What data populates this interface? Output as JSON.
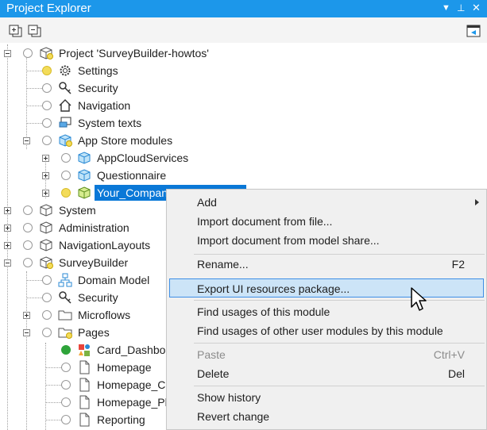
{
  "panel": {
    "title": "Project Explorer"
  },
  "tree": {
    "project": "Project 'SurveyBuilder-howtos'",
    "settings": "Settings",
    "security": "Security",
    "navigation": "Navigation",
    "system_texts": "System texts",
    "app_store_modules": "App Store modules",
    "app_cloud_services": "AppCloudServices",
    "questionnaire": "Questionnaire",
    "your_company": "Your_CompanyUI_R",
    "system": "System",
    "administration": "Administration",
    "navigation_layouts": "NavigationLayouts",
    "survey_builder": "SurveyBuilder",
    "domain_model": "Domain Model",
    "sb_security": "Security",
    "microflows": "Microflows",
    "pages": "Pages",
    "card_dashboard": "Card_Dashboar",
    "homepage": "Homepage",
    "homepage_cre": "Homepage_Cre",
    "homepage_pho": "Homepage_Pho",
    "reporting": "Reporting"
  },
  "menu": {
    "add": "Add",
    "import_file": "Import document from file...",
    "import_share": "Import document from model share...",
    "rename": "Rename...",
    "rename_shortcut": "F2",
    "export": "Export UI resources package...",
    "find_usages": "Find usages of this module",
    "find_other": "Find usages of other user modules by this module",
    "paste": "Paste",
    "paste_shortcut": "Ctrl+V",
    "delete": "Delete",
    "delete_shortcut": "Del",
    "show_history": "Show history",
    "revert": "Revert change"
  }
}
